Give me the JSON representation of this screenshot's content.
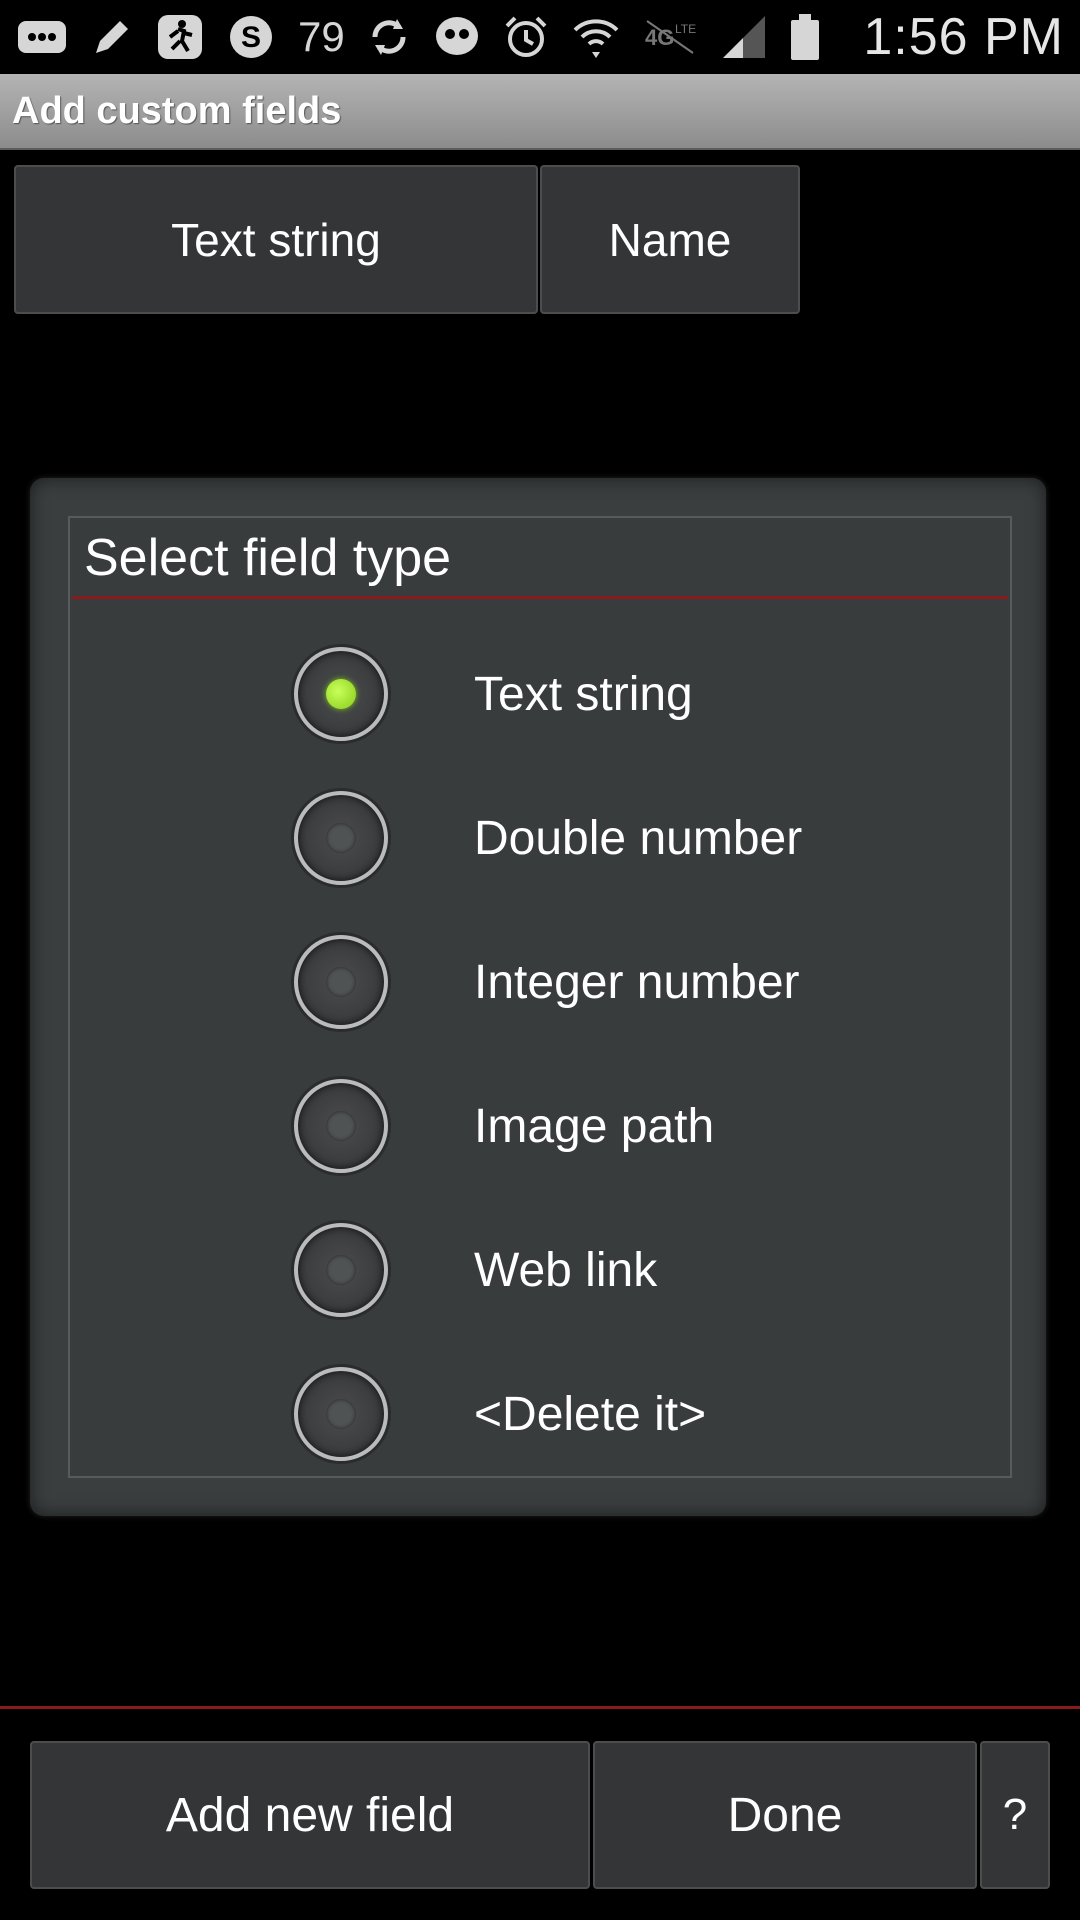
{
  "status_bar": {
    "icons": [
      "chat-icon",
      "pencil-icon",
      "runner-icon",
      "skype-icon"
    ],
    "badge_count": "79",
    "icons_right": [
      "sync-icon",
      "chat-bubble-icon",
      "alarm-icon",
      "wifi-icon",
      "lte-icon",
      "signal-icon",
      "battery-icon"
    ],
    "time": "1:56 PM"
  },
  "title_bar": {
    "title": "Add custom fields"
  },
  "field_row": {
    "type_label": "Text string",
    "name_label": "Name"
  },
  "dialog": {
    "title": "Select field type",
    "options": [
      {
        "label": "Text string",
        "checked": true
      },
      {
        "label": "Double number",
        "checked": false
      },
      {
        "label": "Integer number",
        "checked": false
      },
      {
        "label": "Image path",
        "checked": false
      },
      {
        "label": "Web link",
        "checked": false
      },
      {
        "label": "<Delete it>",
        "checked": false
      }
    ]
  },
  "bottom_bar": {
    "add_label": "Add new field",
    "done_label": "Done",
    "help_label": "?"
  },
  "colors": {
    "accent_divider": "#8b1a1a",
    "radio_selected": "#88cc1a",
    "button_bg": "#333536",
    "dialog_bg": "#3a3e3f"
  }
}
